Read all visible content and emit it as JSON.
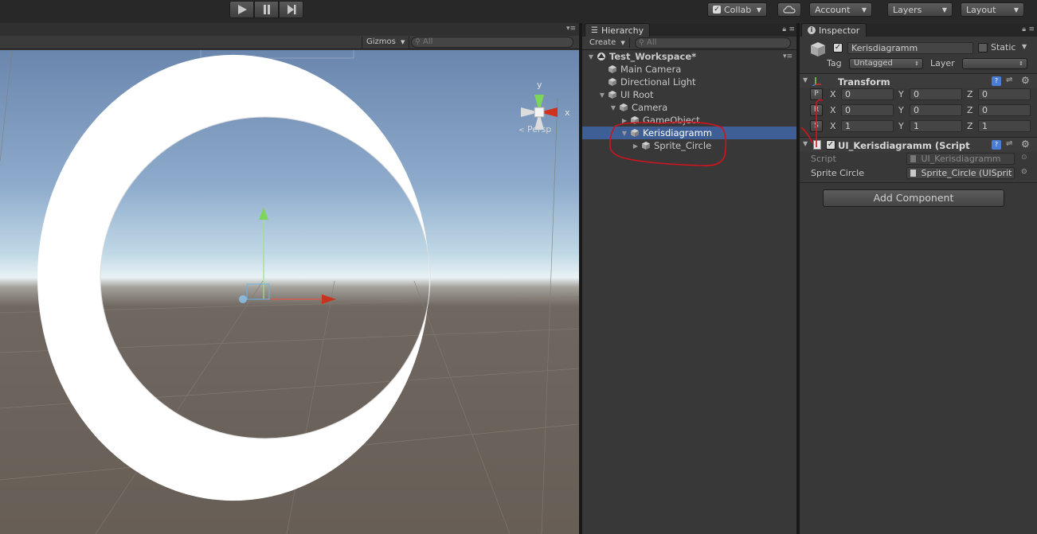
{
  "toolbar": {
    "collab": "Collab",
    "account": "Account",
    "layers": "Layers",
    "layout": "Layout"
  },
  "scene": {
    "gizmos": "Gizmos",
    "search_placeholder": "All",
    "persp": "Persp",
    "gizmo_y": "y",
    "gizmo_x": "x"
  },
  "hierarchy": {
    "tab": "Hierarchy",
    "create": "Create",
    "search_placeholder": "All",
    "items": [
      {
        "label": "Test_Workspace*",
        "depth": 0,
        "expanded": true,
        "scene": true
      },
      {
        "label": "Main Camera",
        "depth": 1
      },
      {
        "label": "Directional Light",
        "depth": 1
      },
      {
        "label": "UI Root",
        "depth": 1,
        "expanded": true
      },
      {
        "label": "Camera",
        "depth": 2,
        "expanded": true
      },
      {
        "label": "GameObject",
        "depth": 3,
        "collapsed": true
      },
      {
        "label": "Kerisdiagramm",
        "depth": 3,
        "expanded": true,
        "selected": true
      },
      {
        "label": "Sprite_Circle",
        "depth": 4,
        "collapsed": true
      }
    ]
  },
  "inspector": {
    "tab": "Inspector",
    "object_name": "Kerisdiagramm",
    "static_label": "Static",
    "tag_label": "Tag",
    "tag_value": "Untagged",
    "layer_label": "Layer",
    "layer_value": "",
    "transform": {
      "title": "Transform",
      "rows": [
        {
          "btn": "P",
          "x": "0",
          "y": "0",
          "z": "0"
        },
        {
          "btn": "R",
          "x": "0",
          "y": "0",
          "z": "0"
        },
        {
          "btn": "S",
          "x": "1",
          "y": "1",
          "z": "1"
        }
      ],
      "axis_x": "X",
      "axis_y": "Y",
      "axis_z": "Z"
    },
    "script_component": {
      "title": "UI_Kerisdiagramm (Script",
      "script_label": "Script",
      "script_value": "UI_Kerisdiagramm",
      "sprite_label": "Sprite Circle",
      "sprite_value": "Sprite_Circle (UISprit"
    },
    "add_component": "Add Component"
  },
  "colors": {
    "selection": "#3e5f96",
    "annotation": "#d0141e"
  }
}
